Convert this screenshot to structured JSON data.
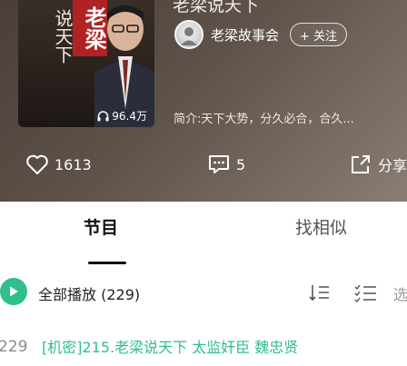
{
  "header": {
    "show_title": "老梁说天下",
    "cover": {
      "title_chars": "老梁",
      "subtitle_chars": "说天下",
      "plays": "96.4万"
    },
    "author": "老梁故事会",
    "follow_label": "+ 关注",
    "intro": "简介:天下大势，分久必合，合久...",
    "stats": {
      "likes": "1613",
      "comments": "5",
      "share_label": "分享"
    }
  },
  "tabs": {
    "active": "节目",
    "inactive": "找相似"
  },
  "playlist": {
    "play_all_label": "全部播放",
    "count": "(229)",
    "select_label": "选"
  },
  "episodes": [
    {
      "number": "229",
      "title": "[机密]215.老梁说天下 太监奸臣 魏忠贤"
    }
  ],
  "colors": {
    "accent": "#2fbf8a",
    "header_bg": "#5e524a",
    "cover_red": "#b32222"
  }
}
